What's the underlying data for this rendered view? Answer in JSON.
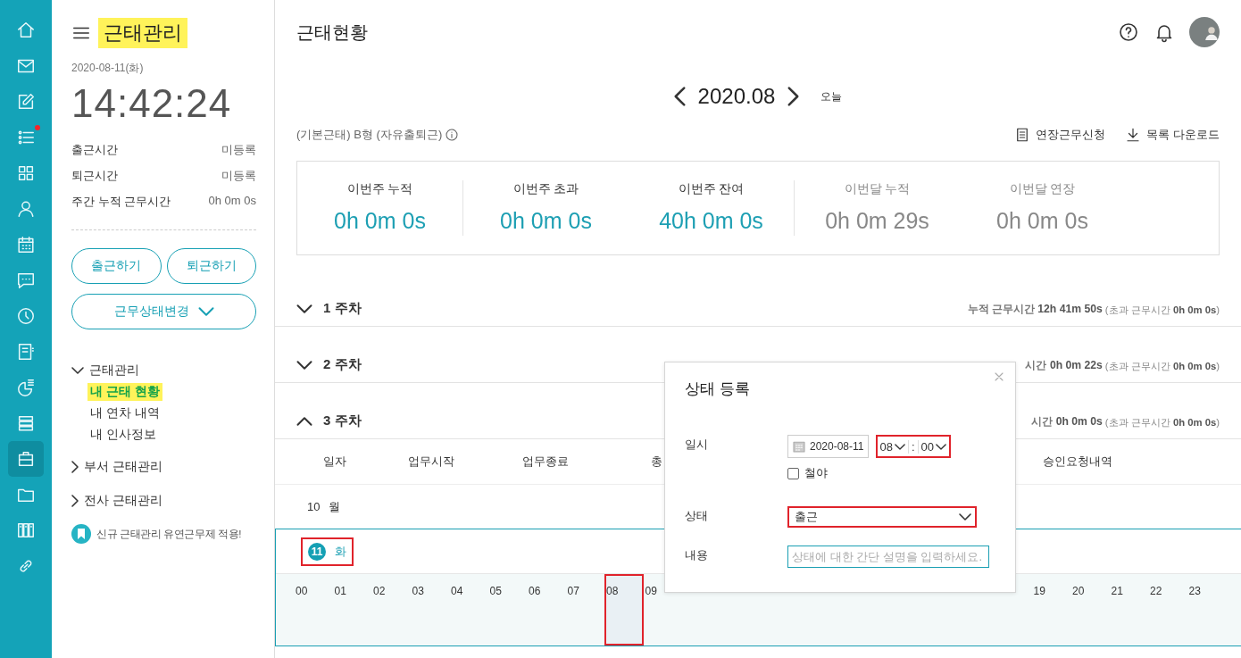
{
  "rail": [
    {
      "selected": false,
      "badge": false
    },
    {
      "selected": false,
      "badge": false
    },
    {
      "selected": false,
      "badge": false
    },
    {
      "selected": false,
      "badge": true
    },
    {
      "selected": false,
      "badge": false
    },
    {
      "selected": false,
      "badge": false
    },
    {
      "selected": false,
      "badge": false
    },
    {
      "selected": false,
      "badge": false
    },
    {
      "selected": false,
      "badge": false
    },
    {
      "selected": false,
      "badge": false
    },
    {
      "selected": false,
      "badge": false
    },
    {
      "selected": false,
      "badge": false
    },
    {
      "selected": true,
      "badge": false
    },
    {
      "selected": false,
      "badge": false
    },
    {
      "selected": false,
      "badge": false
    },
    {
      "selected": false,
      "badge": false
    }
  ],
  "app": {
    "title": "근태관리",
    "date": "2020-08-11(화)",
    "clock": "14:42:24"
  },
  "stats": [
    {
      "label": "출근시간",
      "value": "미등록"
    },
    {
      "label": "퇴근시간",
      "value": "미등록"
    },
    {
      "label": "주간 누적 근무시간",
      "value": "0h 0m 0s"
    }
  ],
  "buttons": [
    "출근하기",
    "퇴근하기"
  ],
  "status_button": "근무상태변경",
  "menu": [
    {
      "label": "근태관리",
      "expanded": true,
      "children": [
        {
          "label": "내 근태 현황",
          "selected": true
        },
        {
          "label": "내 연차 내역",
          "selected": false
        },
        {
          "label": "내 인사정보",
          "selected": false
        }
      ]
    },
    {
      "label": "부서 근태관리",
      "expanded": false
    },
    {
      "label": "전사 근태관리",
      "expanded": false
    }
  ],
  "notice": "신규 근태관리 유연근무제 적용!",
  "page": {
    "title": "근태현황"
  },
  "month": {
    "label": "2020.08",
    "today": "오늘"
  },
  "work_type": "(기본근태) B형 (자유출퇴근)",
  "actions": [
    "연장근무신청",
    "목록 다운로드"
  ],
  "summary_groups": [
    {
      "kind": "week",
      "items": [
        {
          "label": "이번주 누적",
          "value": "0h 0m 0s"
        }
      ]
    },
    {
      "kind": "week",
      "items": [
        {
          "label": "이번주 초과",
          "value": "0h 0m 0s"
        },
        {
          "label": "이번주 잔여",
          "value": "40h 0m 0s"
        }
      ]
    },
    {
      "kind": "month",
      "items": [
        {
          "label": "이번달 누적",
          "value": "0h 0m 29s"
        },
        {
          "label": "이번달 연장",
          "value": "0h 0m 0s"
        }
      ]
    }
  ],
  "weeks": [
    {
      "label": "1 주차",
      "expanded": false,
      "total": "누적 근무시간 **12h 41m 50s**",
      "extra": "(초과 근무시간 **0h 0m 0s**)"
    },
    {
      "label": "2 주차",
      "expanded": false,
      "total": "시간 **0h 0m 22s**",
      "extra": "(초과 근무시간 **0h 0m 0s**)"
    },
    {
      "label": "3 주차",
      "expanded": true,
      "total": "시간 **0h 0m 0s**",
      "extra": "(초과 근무시간 **0h 0m 0s**)"
    }
  ],
  "table": {
    "columns": [
      "일자",
      "업무시작",
      "업무종료",
      "총",
      "승인요청내역"
    ]
  },
  "days": [
    {
      "day": "10",
      "weekday": "월",
      "selected": false
    },
    {
      "day": "11",
      "weekday": "화",
      "selected": true
    }
  ],
  "hours": [
    {
      "label": "00",
      "selected": false
    },
    {
      "label": "01",
      "selected": false
    },
    {
      "label": "02",
      "selected": false
    },
    {
      "label": "03",
      "selected": false
    },
    {
      "label": "04",
      "selected": false
    },
    {
      "label": "05",
      "selected": false
    },
    {
      "label": "06",
      "selected": false
    },
    {
      "label": "07",
      "selected": false
    },
    {
      "label": "08",
      "selected": true
    },
    {
      "label": "09",
      "selected": false
    }
  ],
  "hours_end": [
    {
      "label": "19",
      "selected": false
    },
    {
      "label": "20",
      "selected": false
    },
    {
      "label": "21",
      "selected": false
    },
    {
      "label": "22",
      "selected": false
    },
    {
      "label": "23",
      "selected": false
    }
  ],
  "dialog": {
    "title": "상태 등록",
    "date_label": "일시",
    "date": "2020-08-11",
    "hour": "08",
    "time_separator": ":",
    "minute": "00",
    "night_label": "철야",
    "night_checked": false,
    "status_label": "상태",
    "status": "출근",
    "content_label": "내용",
    "placeholder": "상태에 대한 간단 설명을 입력하세요."
  }
}
